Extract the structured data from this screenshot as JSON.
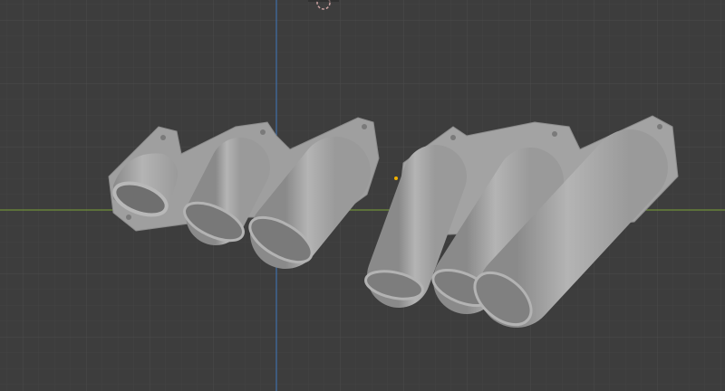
{
  "viewport": {
    "background_color": "#3d3d3d",
    "grid_color": "#474747",
    "x_axis_color": "#6f8f3a",
    "y_axis_color": "#3f6fa8",
    "mesh_color": "#a8a8a8",
    "origin_color": "#f0b000"
  }
}
